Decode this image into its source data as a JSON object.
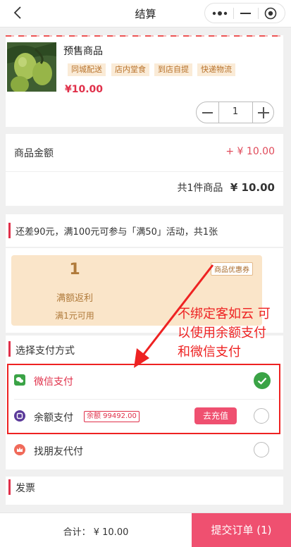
{
  "header": {
    "title": "结算"
  },
  "product": {
    "name": "预售商品",
    "tags": [
      "同城配送",
      "店内堂食",
      "到店自提",
      "快递物流"
    ],
    "price": "¥10.00",
    "quantity": "1"
  },
  "summary": {
    "amount_label": "商品金额",
    "amount_value": "+ ¥ 10.00",
    "total_prefix": "共1件商品",
    "total_value": "¥ 10.00"
  },
  "promo": {
    "text": "还差90元，满100元可参与「满50」活动，共1张",
    "coupon_amount": "1",
    "coupon_name": "满额返利",
    "coupon_condition": "满1元可用",
    "coupon_badge": "商品优惠券"
  },
  "payment": {
    "title": "选择支付方式",
    "wechat_label": "微信支付",
    "balance_label": "余额支付",
    "balance_amount": "余额 99492.00",
    "recharge_button": "去充值",
    "friend_label": "找朋友代付"
  },
  "invoice": {
    "title": "发票"
  },
  "annotation": {
    "line1": "不绑定客如云 可",
    "line2": "以使用余额支付",
    "line3": "和微信支付"
  },
  "footer": {
    "total_text": "合计： ¥ 10.00",
    "submit_label": "提交订单 (1)"
  },
  "colors": {
    "accent": "#e0304a",
    "wechat_green": "#3aa346",
    "annotation_red": "#ee2222"
  },
  "icons": [
    "back-icon",
    "more-dots-icon",
    "minimize-icon",
    "target-icon",
    "wechat-pay-icon",
    "balance-wallet-icon",
    "friend-crown-icon",
    "check-circle-icon"
  ]
}
